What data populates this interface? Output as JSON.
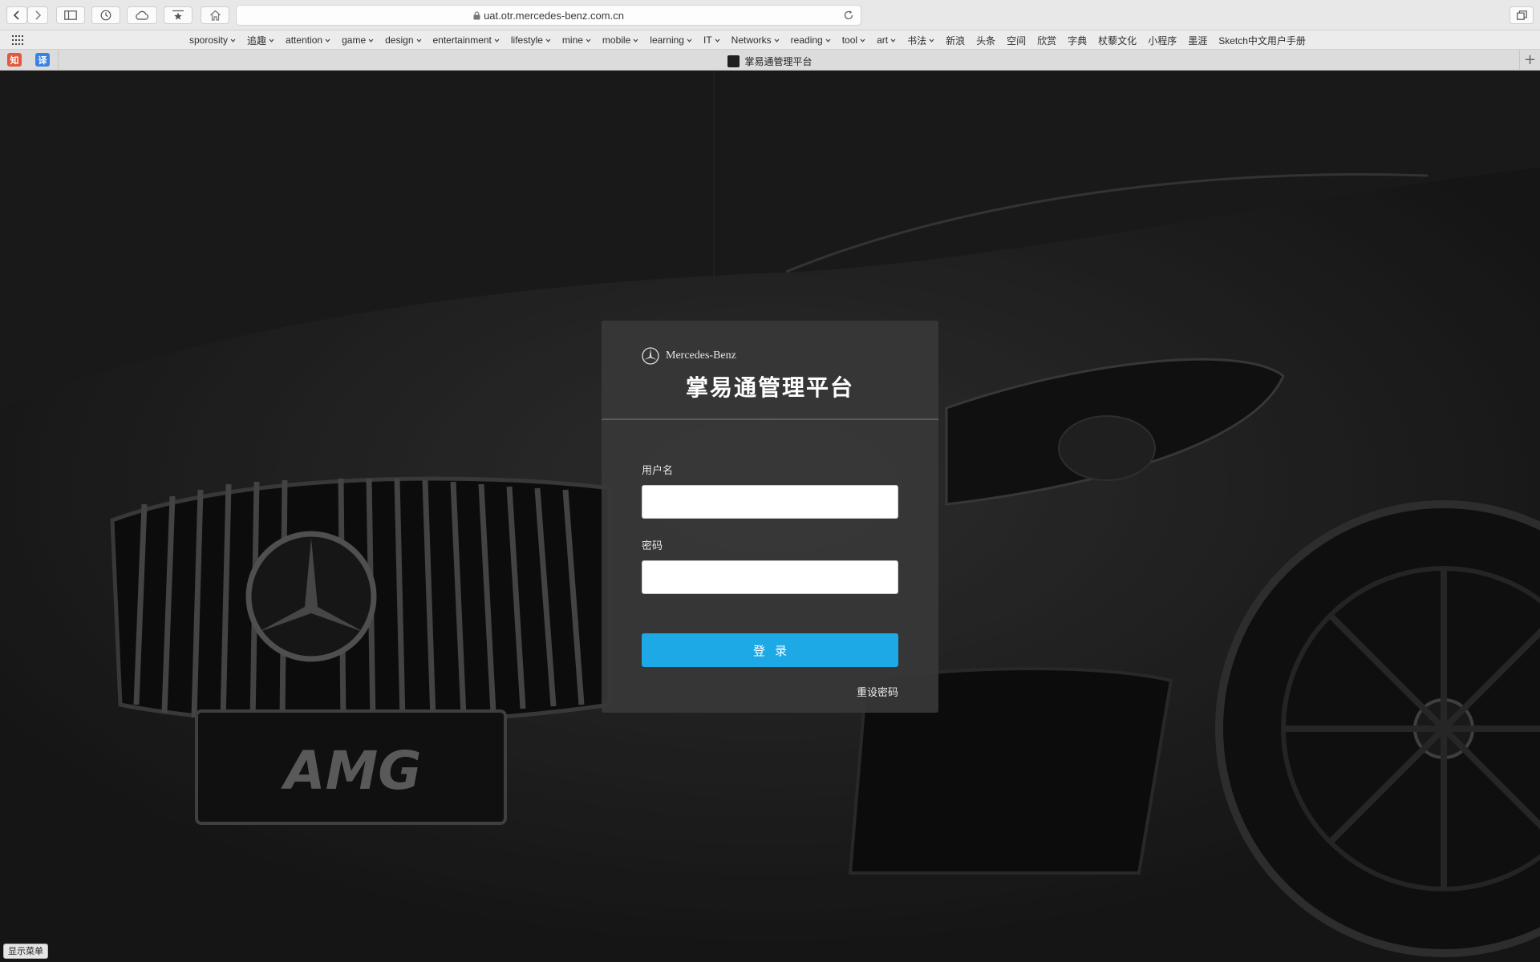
{
  "browser": {
    "address": "uat.otr.mercedes-benz.com.cn",
    "bookmarks": [
      {
        "label": "sporosity",
        "dropdown": true
      },
      {
        "label": "追趣",
        "dropdown": true
      },
      {
        "label": "attention",
        "dropdown": true
      },
      {
        "label": "game",
        "dropdown": true
      },
      {
        "label": "design",
        "dropdown": true
      },
      {
        "label": "entertainment",
        "dropdown": true
      },
      {
        "label": "lifestyle",
        "dropdown": true
      },
      {
        "label": "mine",
        "dropdown": true
      },
      {
        "label": "mobile",
        "dropdown": true
      },
      {
        "label": "learning",
        "dropdown": true
      },
      {
        "label": "IT",
        "dropdown": true
      },
      {
        "label": "Networks",
        "dropdown": true
      },
      {
        "label": "reading",
        "dropdown": true
      },
      {
        "label": "tool",
        "dropdown": true
      },
      {
        "label": "art",
        "dropdown": true
      },
      {
        "label": "书法",
        "dropdown": true
      },
      {
        "label": "新浪",
        "dropdown": false
      },
      {
        "label": "头条",
        "dropdown": false
      },
      {
        "label": "空间",
        "dropdown": false
      },
      {
        "label": "欣赏",
        "dropdown": false
      },
      {
        "label": "字典",
        "dropdown": false
      },
      {
        "label": "杖藜文化",
        "dropdown": false
      },
      {
        "label": "小程序",
        "dropdown": false
      },
      {
        "label": "墨涯",
        "dropdown": false
      },
      {
        "label": "Sketch中文用户手册",
        "dropdown": false
      }
    ],
    "pinned_tabs": [
      {
        "glyph": "知",
        "color": "#e1583f"
      },
      {
        "glyph": "译",
        "color": "#3a82e0"
      }
    ],
    "tab_title": "掌易通管理平台",
    "new_tab_glyph": "+",
    "show_menu_label": "显示菜单"
  },
  "login": {
    "brand": "Mercedes-Benz",
    "title": "掌易通管理平台",
    "username_label": "用户名",
    "username_value": "",
    "password_label": "密码",
    "password_value": "",
    "login_button": "登录",
    "reset_link": "重设密码",
    "accent_color": "#1da8e6"
  },
  "background": {
    "plate_text": "AMG"
  }
}
